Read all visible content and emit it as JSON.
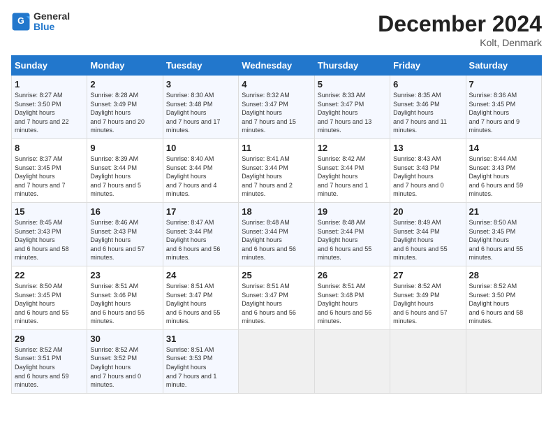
{
  "header": {
    "logo_general": "General",
    "logo_blue": "Blue",
    "title": "December 2024",
    "location": "Kolt, Denmark"
  },
  "days_of_week": [
    "Sunday",
    "Monday",
    "Tuesday",
    "Wednesday",
    "Thursday",
    "Friday",
    "Saturday"
  ],
  "weeks": [
    [
      {
        "day": "1",
        "sunrise": "8:27 AM",
        "sunset": "3:50 PM",
        "daylight": "7 hours and 22 minutes."
      },
      {
        "day": "2",
        "sunrise": "8:28 AM",
        "sunset": "3:49 PM",
        "daylight": "7 hours and 20 minutes."
      },
      {
        "day": "3",
        "sunrise": "8:30 AM",
        "sunset": "3:48 PM",
        "daylight": "7 hours and 17 minutes."
      },
      {
        "day": "4",
        "sunrise": "8:32 AM",
        "sunset": "3:47 PM",
        "daylight": "7 hours and 15 minutes."
      },
      {
        "day": "5",
        "sunrise": "8:33 AM",
        "sunset": "3:47 PM",
        "daylight": "7 hours and 13 minutes."
      },
      {
        "day": "6",
        "sunrise": "8:35 AM",
        "sunset": "3:46 PM",
        "daylight": "7 hours and 11 minutes."
      },
      {
        "day": "7",
        "sunrise": "8:36 AM",
        "sunset": "3:45 PM",
        "daylight": "7 hours and 9 minutes."
      }
    ],
    [
      {
        "day": "8",
        "sunrise": "8:37 AM",
        "sunset": "3:45 PM",
        "daylight": "7 hours and 7 minutes."
      },
      {
        "day": "9",
        "sunrise": "8:39 AM",
        "sunset": "3:44 PM",
        "daylight": "7 hours and 5 minutes."
      },
      {
        "day": "10",
        "sunrise": "8:40 AM",
        "sunset": "3:44 PM",
        "daylight": "7 hours and 4 minutes."
      },
      {
        "day": "11",
        "sunrise": "8:41 AM",
        "sunset": "3:44 PM",
        "daylight": "7 hours and 2 minutes."
      },
      {
        "day": "12",
        "sunrise": "8:42 AM",
        "sunset": "3:44 PM",
        "daylight": "7 hours and 1 minute."
      },
      {
        "day": "13",
        "sunrise": "8:43 AM",
        "sunset": "3:43 PM",
        "daylight": "7 hours and 0 minutes."
      },
      {
        "day": "14",
        "sunrise": "8:44 AM",
        "sunset": "3:43 PM",
        "daylight": "6 hours and 59 minutes."
      }
    ],
    [
      {
        "day": "15",
        "sunrise": "8:45 AM",
        "sunset": "3:43 PM",
        "daylight": "6 hours and 58 minutes."
      },
      {
        "day": "16",
        "sunrise": "8:46 AM",
        "sunset": "3:43 PM",
        "daylight": "6 hours and 57 minutes."
      },
      {
        "day": "17",
        "sunrise": "8:47 AM",
        "sunset": "3:44 PM",
        "daylight": "6 hours and 56 minutes."
      },
      {
        "day": "18",
        "sunrise": "8:48 AM",
        "sunset": "3:44 PM",
        "daylight": "6 hours and 56 minutes."
      },
      {
        "day": "19",
        "sunrise": "8:48 AM",
        "sunset": "3:44 PM",
        "daylight": "6 hours and 55 minutes."
      },
      {
        "day": "20",
        "sunrise": "8:49 AM",
        "sunset": "3:44 PM",
        "daylight": "6 hours and 55 minutes."
      },
      {
        "day": "21",
        "sunrise": "8:50 AM",
        "sunset": "3:45 PM",
        "daylight": "6 hours and 55 minutes."
      }
    ],
    [
      {
        "day": "22",
        "sunrise": "8:50 AM",
        "sunset": "3:45 PM",
        "daylight": "6 hours and 55 minutes."
      },
      {
        "day": "23",
        "sunrise": "8:51 AM",
        "sunset": "3:46 PM",
        "daylight": "6 hours and 55 minutes."
      },
      {
        "day": "24",
        "sunrise": "8:51 AM",
        "sunset": "3:47 PM",
        "daylight": "6 hours and 55 minutes."
      },
      {
        "day": "25",
        "sunrise": "8:51 AM",
        "sunset": "3:47 PM",
        "daylight": "6 hours and 56 minutes."
      },
      {
        "day": "26",
        "sunrise": "8:51 AM",
        "sunset": "3:48 PM",
        "daylight": "6 hours and 56 minutes."
      },
      {
        "day": "27",
        "sunrise": "8:52 AM",
        "sunset": "3:49 PM",
        "daylight": "6 hours and 57 minutes."
      },
      {
        "day": "28",
        "sunrise": "8:52 AM",
        "sunset": "3:50 PM",
        "daylight": "6 hours and 58 minutes."
      }
    ],
    [
      {
        "day": "29",
        "sunrise": "8:52 AM",
        "sunset": "3:51 PM",
        "daylight": "6 hours and 59 minutes."
      },
      {
        "day": "30",
        "sunrise": "8:52 AM",
        "sunset": "3:52 PM",
        "daylight": "7 hours and 0 minutes."
      },
      {
        "day": "31",
        "sunrise": "8:51 AM",
        "sunset": "3:53 PM",
        "daylight": "7 hours and 1 minute."
      },
      null,
      null,
      null,
      null
    ]
  ]
}
